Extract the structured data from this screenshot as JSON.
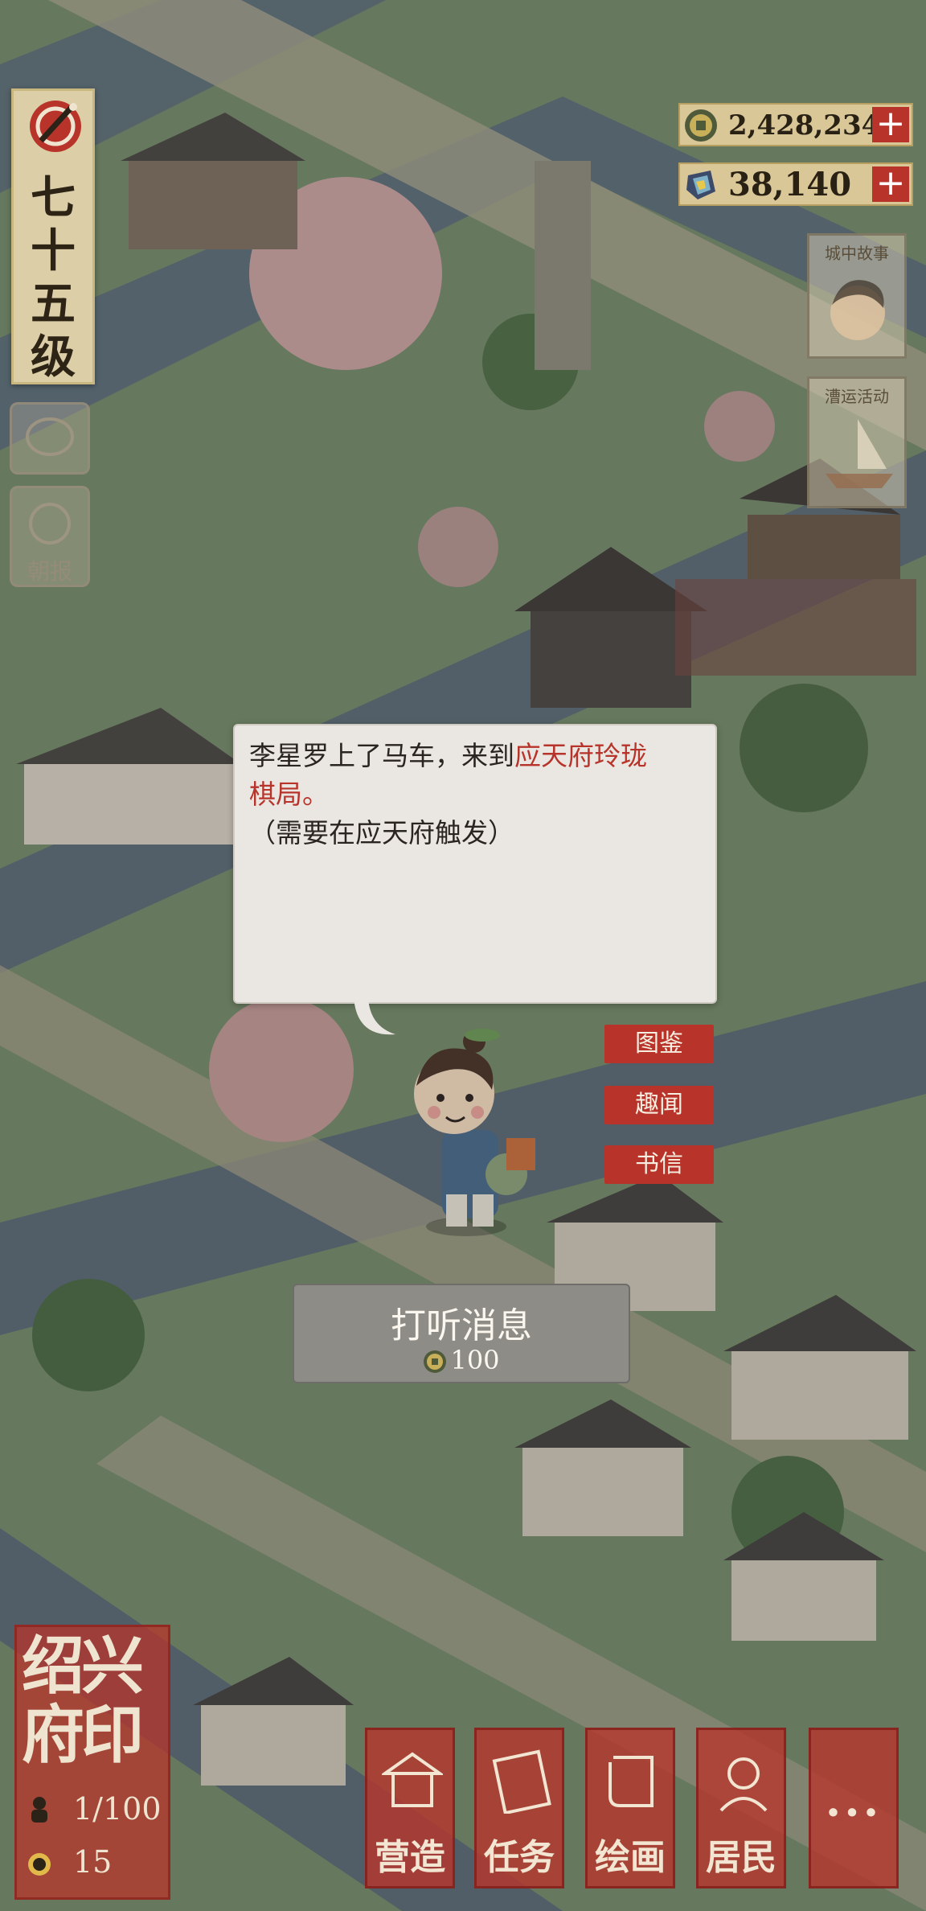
{
  "level": {
    "text": "七十五级"
  },
  "currency": {
    "coins": {
      "value": "2,428,234",
      "plus": "+",
      "icon": "copper-coin-icon"
    },
    "gems": {
      "value": "38,140",
      "plus": "+",
      "icon": "jade-gem-icon"
    }
  },
  "right_panels": {
    "story": "城中故事",
    "event": "漕运活动"
  },
  "left_buttons": {
    "second_label": "朝报"
  },
  "dialog": {
    "line1_prefix": "李星罗上了马车，来到",
    "line1_highlight": "应天府玲珑",
    "line2_highlight": "棋局。",
    "line3": "（需要在应天府触发）"
  },
  "side_menu": {
    "item1": "图鉴",
    "item2": "趣闻",
    "item3": "书信"
  },
  "ask_button": {
    "label": "打听消息",
    "cost": "100"
  },
  "city": {
    "name_line1": "绍兴",
    "name_line2": "府印",
    "population": "1/100",
    "count": "15"
  },
  "toolbar": {
    "build": "营造",
    "tasks": "任务",
    "paint": "绘画",
    "residents": "居民",
    "more": "···"
  },
  "colors": {
    "accent_red": "#b8342b",
    "parchment": "#dccfa8",
    "dialog_bg": "#eae7e2"
  }
}
